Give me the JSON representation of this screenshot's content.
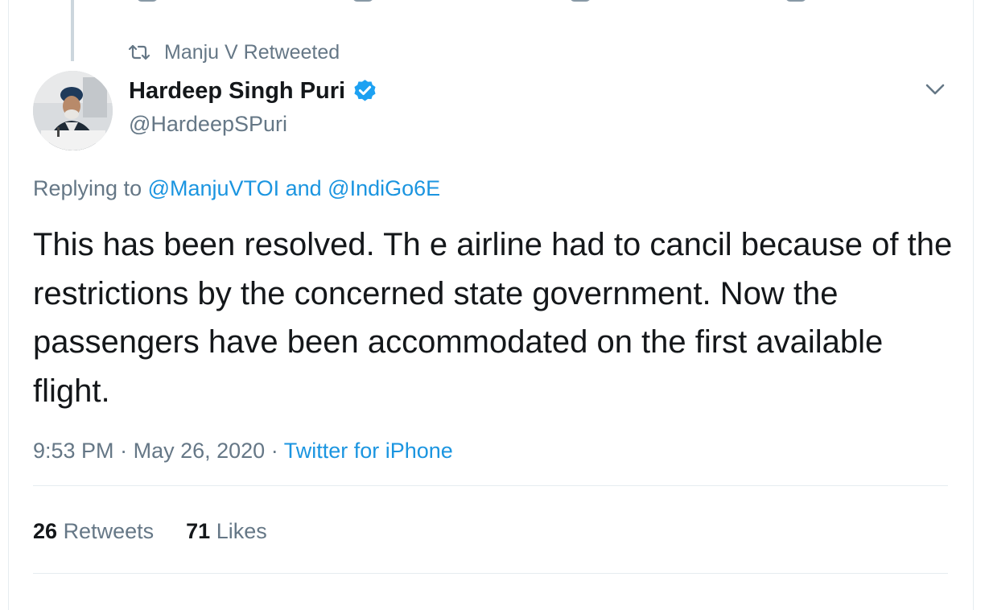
{
  "retweet_context": {
    "icon": "retweet-icon",
    "label": "Manju V Retweeted"
  },
  "author": {
    "display_name": "Hardeep Singh Puri",
    "verified": true,
    "verified_color": "#1da1f2",
    "handle": "@HardeepSPuri",
    "avatar": "avatar"
  },
  "reply_context": {
    "prefix": "Replying to",
    "mention_1": "@ManjuVTOI",
    "conjunction": "and",
    "mention_2": "@IndiGo6E"
  },
  "tweet": {
    "text": "This has been resolved. Th e airline had to cancil because of the restrictions by the concerned state government. Now the passengers have been accommodated on the first available flight."
  },
  "meta": {
    "time": "9:53 PM",
    "separator": "·",
    "date": "May 26, 2020",
    "source": "Twitter for iPhone"
  },
  "stats": {
    "retweets_count": "26",
    "retweets_label": "Retweets",
    "likes_count": "71",
    "likes_label": "Likes"
  },
  "colors": {
    "link": "#1b95e0",
    "secondary_text": "#657786",
    "primary_text": "#14171a",
    "divider": "#e6ecf0"
  },
  "icons": {
    "more_menu": "chevron-down-icon"
  }
}
